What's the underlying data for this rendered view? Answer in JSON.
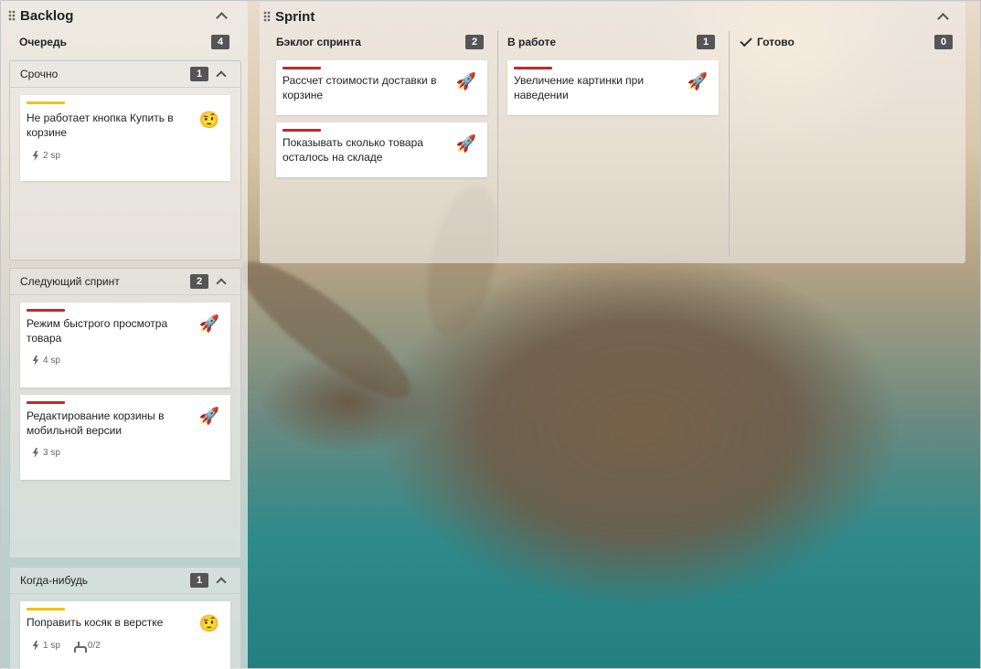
{
  "backlog": {
    "title": "Backlog",
    "queue": {
      "label": "Очередь",
      "count": "4"
    },
    "groups": [
      {
        "label": "Срочно",
        "count": "1",
        "cards": [
          {
            "title": "Не работает кнопка Купить в корзине",
            "points": "2 sp",
            "stripe_color": "#f4c20d",
            "icon": "🤨"
          }
        ]
      },
      {
        "label": "Следующий спринт",
        "count": "2",
        "cards": [
          {
            "title": "Режим быстрого просмотра товара",
            "points": "4 sp",
            "stripe_color": "#c62828",
            "icon": "🚀"
          },
          {
            "title": "Редактирование корзины в мобильной версии",
            "points": "3 sp",
            "stripe_color": "#c62828",
            "icon": "🚀"
          }
        ]
      },
      {
        "label": "Когда-нибудь",
        "count": "1",
        "cards": [
          {
            "title": "Поправить косяк в верстке",
            "points": "1 sp",
            "subtasks": "0/2",
            "stripe_color": "#f4c20d",
            "icon": "🤨"
          }
        ]
      }
    ]
  },
  "sprint": {
    "title": "Sprint",
    "columns": [
      {
        "label": "Бэклог спринта",
        "count": "2",
        "cards": [
          {
            "title": "Рассчет стоимости доставки в корзине",
            "stripe_color": "#c62828",
            "icon": "🚀"
          },
          {
            "title": "Показывать сколько товара осталось на складе",
            "stripe_color": "#c62828",
            "icon": "🚀"
          }
        ]
      },
      {
        "label": "В работе",
        "count": "1",
        "cards": [
          {
            "title": "Увеличение картинки при наведении",
            "stripe_color": "#c62828",
            "icon": "🚀"
          }
        ]
      },
      {
        "label": "Готово",
        "count": "0",
        "cards": []
      }
    ]
  },
  "icons": {
    "drag": "drag-handle-icon",
    "collapse": "chevron-up-icon",
    "points": "lightning-icon",
    "subtasks": "branch-icon",
    "done": "check-icon",
    "priority_low": "raised-eyebrow-emoji",
    "priority_high": "rocket-emoji"
  }
}
